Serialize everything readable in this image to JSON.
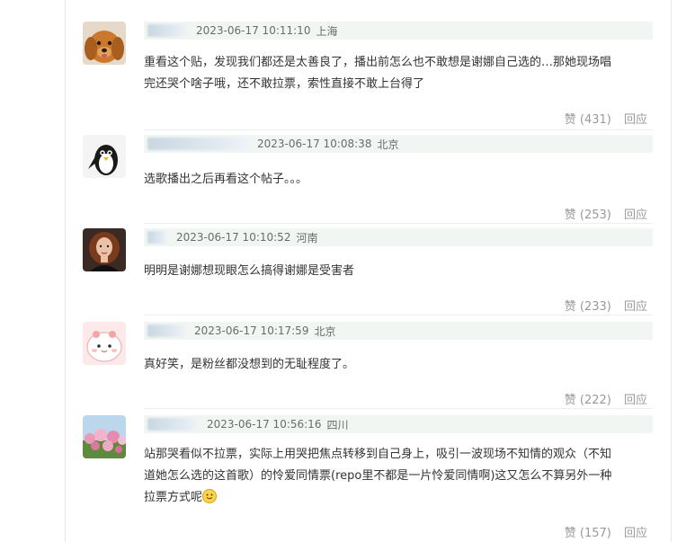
{
  "comments": [
    {
      "avatar": "dog-avatar",
      "time": "2023-06-17 10:11:10",
      "location": "上海",
      "text_lines": [
        "重看这个贴，发现我们都还是太善良了，播出前怎么也不敢想是谢娜自己选的…那她现场唱",
        "完还哭个啥子哦，还不敢拉票，索性直接不敢上台得了"
      ],
      "like_label": "赞 (431)",
      "reply_label": "回应"
    },
    {
      "avatar": "penguin-avatar",
      "time": "2023-06-17 10:08:38",
      "location": "北京",
      "text_lines": [
        "选歌播出之后再看这个帖子。。。"
      ],
      "like_label": "赞 (253)",
      "reply_label": "回应"
    },
    {
      "avatar": "woman-avatar",
      "time": "2023-06-17 10:10:52",
      "location": "河南",
      "text_lines": [
        "明明是谢娜想现眼怎么搞得谢娜是受害者"
      ],
      "like_label": "赞 (233)",
      "reply_label": "回应"
    },
    {
      "avatar": "pink-cartoon-avatar",
      "time": "2023-06-17 10:17:59",
      "location": "北京",
      "text_lines": [
        "真好笑，是粉丝都没想到的无耻程度了。"
      ],
      "like_label": "赞 (222)",
      "reply_label": "回应"
    },
    {
      "avatar": "flowers-avatar",
      "time": "2023-06-17 10:56:16",
      "location": "四川",
      "text_lines": [
        "站那哭看似不拉票，实际上用哭把焦点转移到自己身上，吸引一波现场不知情的观众（不知",
        "道她怎么选的这首歌）的怜爱同情票(repo里不都是一片怜爱同情啊)这又怎么不算另外一种",
        "拉票方式呢"
      ],
      "has_emoji": true,
      "like_label": "赞 (157)",
      "reply_label": "回应"
    }
  ]
}
